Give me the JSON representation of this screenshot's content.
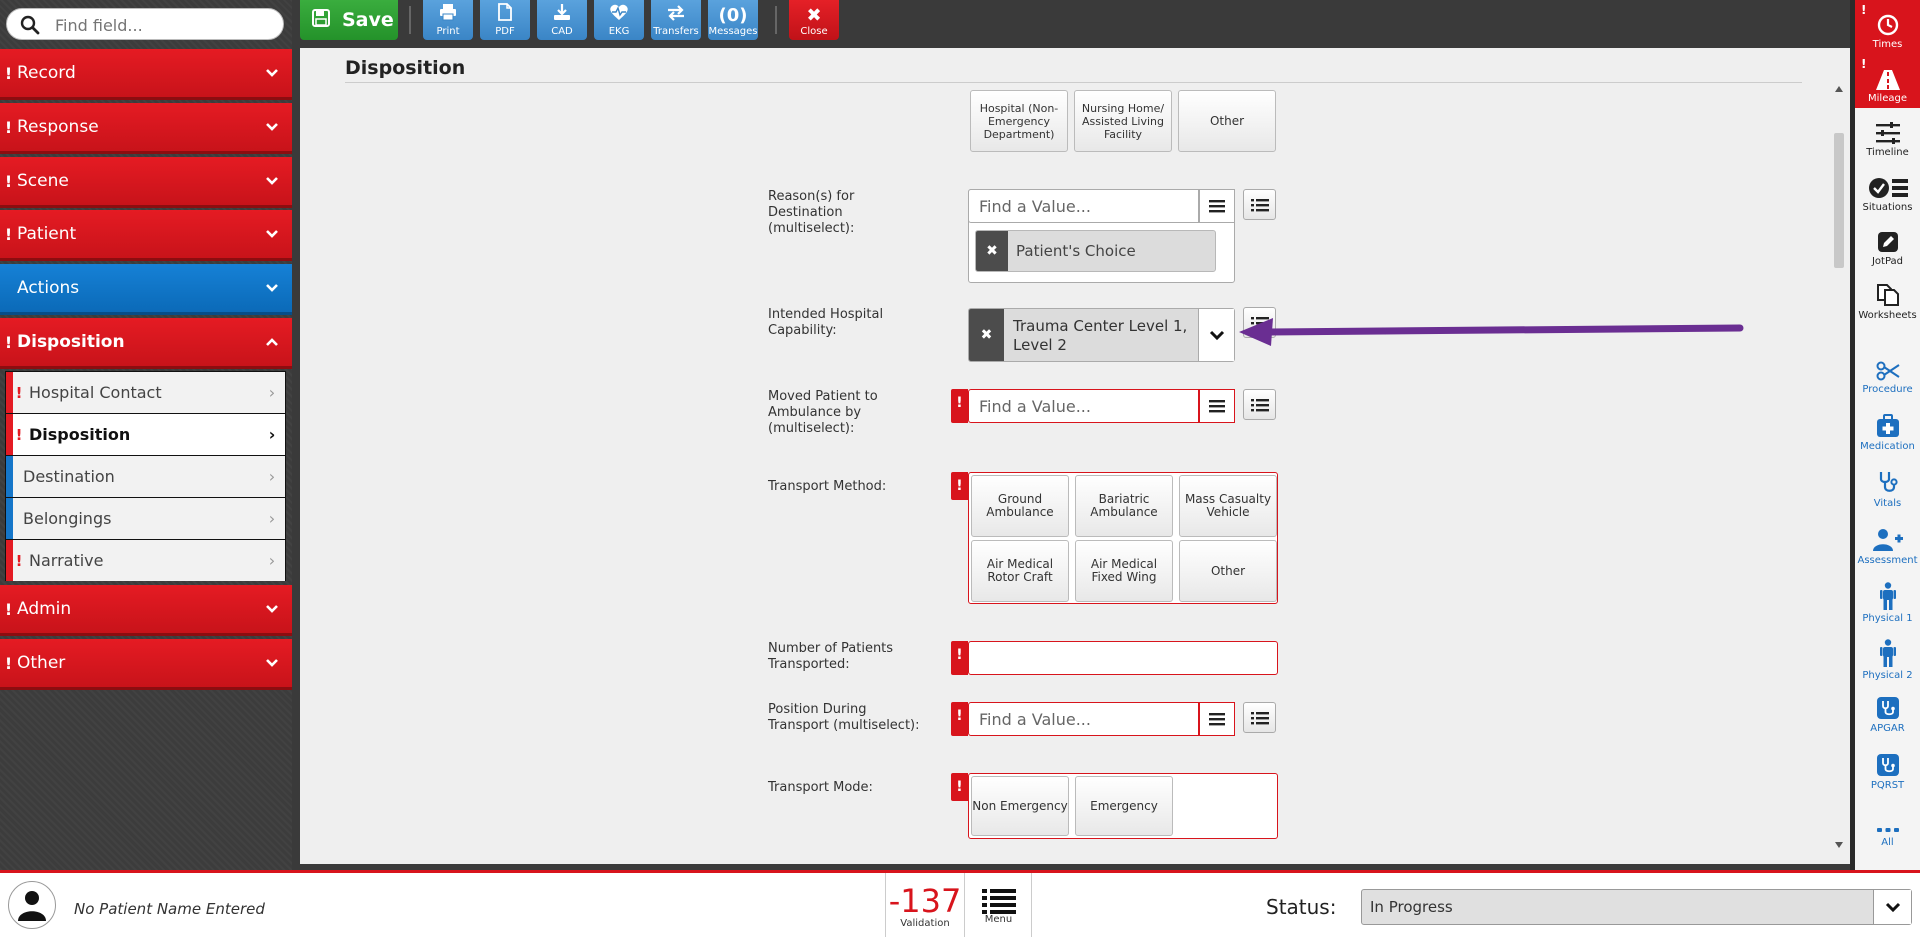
{
  "search": {
    "placeholder": "Find field..."
  },
  "sidebar": {
    "items": [
      {
        "label": "Record",
        "required": "!"
      },
      {
        "label": "Response",
        "required": "!"
      },
      {
        "label": "Scene",
        "required": "!"
      },
      {
        "label": "Patient",
        "required": "!"
      },
      {
        "label": "Actions",
        "required": ""
      },
      {
        "label": "Disposition",
        "required": "!"
      },
      {
        "label": "Admin",
        "required": "!"
      },
      {
        "label": "Other",
        "required": "!"
      }
    ],
    "subitems": [
      {
        "label": "Hospital Contact",
        "required": "!"
      },
      {
        "label": "Disposition",
        "required": "!"
      },
      {
        "label": "Destination",
        "required": ""
      },
      {
        "label": "Belongings",
        "required": ""
      },
      {
        "label": "Narrative",
        "required": "!"
      }
    ]
  },
  "toolbar": {
    "save": "Save",
    "print": "Print",
    "pdf": "PDF",
    "cad": "CAD",
    "ekg": "EKG",
    "transfers": "Transfers",
    "messages_count": "(0)",
    "messages": "Messages",
    "close": "Close"
  },
  "page": {
    "title": "Disposition"
  },
  "form": {
    "destination_options": [
      "Hospital (Non-Emergency Department)",
      "Nursing Home/ Assisted Living Facility",
      "Other"
    ],
    "reasons": {
      "label": "Reason(s) for Destination (multiselect):",
      "placeholder": "Find a Value...",
      "selected": "Patient's Choice"
    },
    "capability": {
      "label": "Intended Hospital Capability:",
      "selected_line1": "Trauma Center Level 1,",
      "selected_line2": "Level 2"
    },
    "moved": {
      "label": "Moved Patient to Ambulance by (multiselect):",
      "placeholder": "Find a Value..."
    },
    "transport_method": {
      "label": "Transport Method:",
      "options": [
        "Ground Ambulance",
        "Bariatric Ambulance",
        "Mass Casualty Vehicle",
        "Air Medical Rotor Craft",
        "Air Medical Fixed Wing",
        "Other"
      ]
    },
    "num_patients": {
      "label": "Number of Patients Transported:",
      "value": ""
    },
    "position": {
      "label": "Position During Transport (multiselect):",
      "placeholder": "Find a Value..."
    },
    "transport_mode": {
      "label": "Transport Mode:",
      "options": [
        "Non Emergency",
        "Emergency"
      ]
    }
  },
  "rail": {
    "items": [
      "Times",
      "Mileage",
      "Timeline",
      "Situations",
      "JotPad",
      "Worksheets",
      "Procedure",
      "Medication",
      "Vitals",
      "Assessment",
      "Physical 1",
      "Physical 2",
      "APGAR",
      "PQRST",
      "All"
    ]
  },
  "bottom": {
    "patient_name": "No Patient Name Entered",
    "validation_count": "-137",
    "validation_label": "Validation",
    "menu_label": "Menu",
    "status_label": "Status:",
    "status_value": "In Progress"
  },
  "colors": {
    "required_red": "#d8141c",
    "actions_blue": "#1681d6",
    "save_green": "#2ea034",
    "arrow_purple": "#6a2e92"
  }
}
